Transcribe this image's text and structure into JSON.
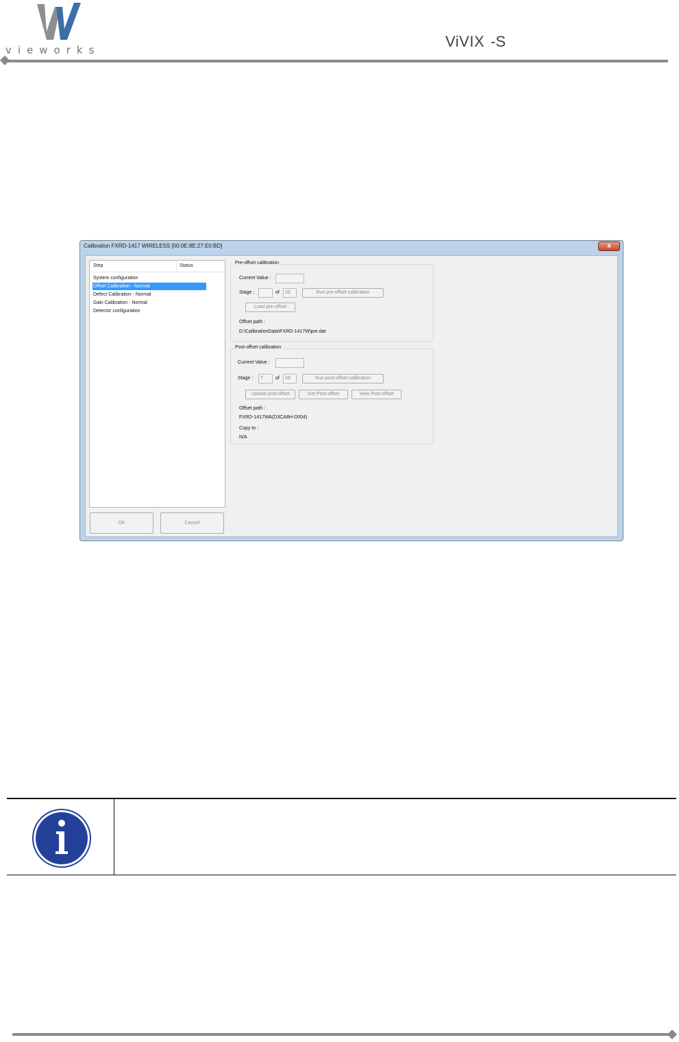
{
  "header": {
    "company_word": "vieworks",
    "product_name": "ViVIX",
    "product_suffix": "-S"
  },
  "dialog": {
    "title": "Calibration  FXRD-1417 WIRELESS [00:0E:8E:27:E0:BD]",
    "close_symbol": "x",
    "steps": {
      "columns": [
        "Step",
        "Status"
      ],
      "items": [
        "System configuration",
        "Offset Calibration - Normal",
        "Defect Calibration - Normal",
        "Gain Calibration - Normal",
        "Detector configuration"
      ],
      "selected_index": 1
    },
    "buttons": {
      "ok": "OK",
      "cancel": "Cancel"
    },
    "pre_offset": {
      "title": "Pre-offset calibration",
      "current_value_label": "Current Value :",
      "current_value": "",
      "stage_label": "Stage :",
      "stage_value": "",
      "of_label": "of",
      "stage_total": "10",
      "run_button": "Run pre-offset calibration",
      "load_button": "Load pre-offset",
      "offset_path_label": "Offset path :",
      "offset_path": "D:\\CalibrationData\\FXRD-1417W\\pre.dat"
    },
    "post_offset": {
      "title": "Post-offset calibration",
      "current_value_label": "Current Value :",
      "current_value": "",
      "stage_label": "Stage :",
      "stage_value": "7",
      "of_label": "of",
      "stage_total": "10",
      "run_button": "Run post-offset calibration",
      "upload_button": "Upload post-offset",
      "get_button": "Get Post offset",
      "view_button": "View Post-offset",
      "offset_path_label": "Offset path :",
      "offset_path": "FXRD-1417WA(D3CA8H-D004)",
      "copy_to_label": "Copy to :",
      "copy_to": "N/A"
    }
  },
  "colors": {
    "accent": "#3a6fa7",
    "selection": "#3399ff",
    "rule": "#8a8a8a",
    "info_circle": "#24419a"
  }
}
